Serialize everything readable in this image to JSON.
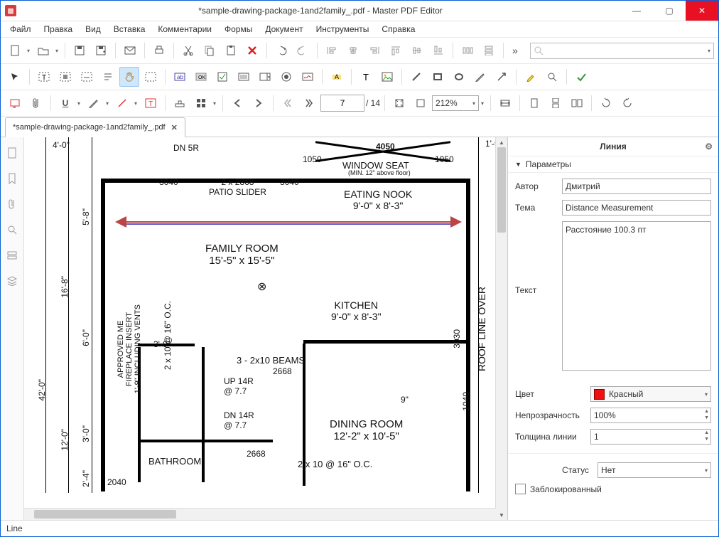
{
  "window": {
    "title": "*sample-drawing-package-1and2family_.pdf - Master PDF Editor"
  },
  "menu": [
    "Файл",
    "Правка",
    "Вид",
    "Вставка",
    "Комментарии",
    "Формы",
    "Документ",
    "Инструменты",
    "Справка"
  ],
  "tab": {
    "label": "*sample-drawing-package-1and2family_.pdf"
  },
  "page": {
    "current": "7",
    "total_label": "/ 14"
  },
  "zoom": {
    "value": "212%"
  },
  "search": {
    "placeholder": ""
  },
  "properties": {
    "title": "Линия",
    "section": "Параметры",
    "author_label": "Автор",
    "author": "Дмитрий",
    "subject_label": "Тема",
    "subject": "Distance Measurement",
    "text_label": "Текст",
    "text": "Расстояние 100.3 пт",
    "color_label": "Цвет",
    "color_name": "Красный",
    "opacity_label": "Непрозрачность",
    "opacity": "100%",
    "linewidth_label": "Толщина линии",
    "linewidth": "1",
    "status_label": "Статус",
    "status_value": "Нет",
    "locked_label": "Заблокированный"
  },
  "status_bar": "Line",
  "floorplan": {
    "dn5r": "DN 5R",
    "top_dim": "4050",
    "t1050a": "1050",
    "t1050b": "1050",
    "windowseat": "WINDOW SEAT",
    "windowseat_sub": "(MIN. 12\" above floor)",
    "d3040a": "3040",
    "d3040b": "3040",
    "patio": "2 x 2868\nPATIO SLIDER",
    "eating": "EATING NOOK\n9'-0\" x 8'-3\"",
    "roof": "ROOF LINE OVER",
    "approved": "APPROVED ME\nFIREPLACE INSERT\n1'-9\" INCLUDING VENTS",
    "a2x10": "2 x 10 @ 16\" O.C.",
    "family": "FAMILY ROOM\n15'-5\" x 15'-5\"",
    "kitchen": "KITCHEN\n9'-0\" x 8'-3\"",
    "d3030": "3030",
    "beams": "3 - 2x10 BEAMS",
    "d2668a": "2668",
    "d2668b": "2668",
    "d30": "3'-0\"",
    "up14": "UP 14R\n@ 7.7",
    "dn14": "DN 14R\n@ 7.7",
    "dining": "DINING ROOM\n12'-2\" x 10'-5\"",
    "d2040": "2040",
    "bathroom": "BATHROOM",
    "bottom2x10": "2 x 10 @ 16\" O.C.",
    "l58": "5'-8\"",
    "l168": "16'-8\"",
    "l60": "6'-0\"",
    "l120": "12'-0\"",
    "l420": "42'-0\"",
    "l30b": "3'-0\"",
    "l24": "2'-4\"",
    "l40": "4'-0\"",
    "l19": "1'-9\"",
    "l1040": "1040",
    "l9": "9\""
  }
}
